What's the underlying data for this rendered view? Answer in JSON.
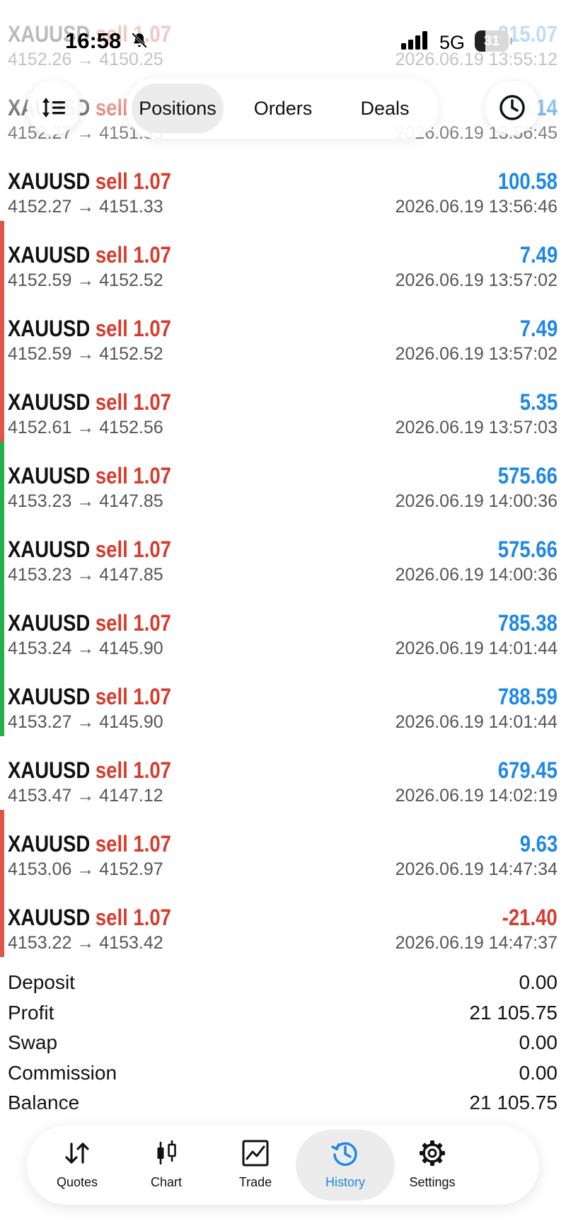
{
  "status_bar": {
    "time": "16:58",
    "network": "5G",
    "battery": "31",
    "battery_level": 0.31
  },
  "segments": {
    "positions": "Positions",
    "orders": "Orders",
    "deals": "Deals",
    "active": "positions"
  },
  "colors": {
    "sell": "#d43d2e",
    "profit_positive": "#1e88e5",
    "profit_negative": "#d43d2e",
    "group_red": "#e05546",
    "group_green": "#22b24c",
    "active_tab": "#1e88e5"
  },
  "deals": [
    {
      "symbol": "XAUUSD",
      "side": "sell",
      "volume": "1.07",
      "prices": "4152.26 → 4150.25",
      "profit": "215.07",
      "time": "2026.06.19 13:55:12",
      "negative": false,
      "group": "none"
    },
    {
      "symbol": "XAUUSD",
      "side": "sell",
      "volume": "1.07",
      "prices": "4152.27 → 4151.33",
      "profit": "100.14",
      "time": "2026.06.19 13:56:45",
      "negative": false,
      "group": "none"
    },
    {
      "symbol": "XAUUSD",
      "side": "sell",
      "volume": "1.07",
      "prices": "4152.27 → 4151.33",
      "profit": "100.58",
      "time": "2026.06.19 13:56:46",
      "negative": false,
      "group": "none"
    },
    {
      "symbol": "XAUUSD",
      "side": "sell",
      "volume": "1.07",
      "prices": "4152.59 → 4152.52",
      "profit": "7.49",
      "time": "2026.06.19 13:57:02",
      "negative": false,
      "group": "red"
    },
    {
      "symbol": "XAUUSD",
      "side": "sell",
      "volume": "1.07",
      "prices": "4152.59 → 4152.52",
      "profit": "7.49",
      "time": "2026.06.19 13:57:02",
      "negative": false,
      "group": "red"
    },
    {
      "symbol": "XAUUSD",
      "side": "sell",
      "volume": "1.07",
      "prices": "4152.61 → 4152.56",
      "profit": "5.35",
      "time": "2026.06.19 13:57:03",
      "negative": false,
      "group": "red"
    },
    {
      "symbol": "XAUUSD",
      "side": "sell",
      "volume": "1.07",
      "prices": "4153.23 → 4147.85",
      "profit": "575.66",
      "time": "2026.06.19 14:00:36",
      "negative": false,
      "group": "green"
    },
    {
      "symbol": "XAUUSD",
      "side": "sell",
      "volume": "1.07",
      "prices": "4153.23 → 4147.85",
      "profit": "575.66",
      "time": "2026.06.19 14:00:36",
      "negative": false,
      "group": "green"
    },
    {
      "symbol": "XAUUSD",
      "side": "sell",
      "volume": "1.07",
      "prices": "4153.24 → 4145.90",
      "profit": "785.38",
      "time": "2026.06.19 14:01:44",
      "negative": false,
      "group": "green"
    },
    {
      "symbol": "XAUUSD",
      "side": "sell",
      "volume": "1.07",
      "prices": "4153.27 → 4145.90",
      "profit": "788.59",
      "time": "2026.06.19 14:01:44",
      "negative": false,
      "group": "green"
    },
    {
      "symbol": "XAUUSD",
      "side": "sell",
      "volume": "1.07",
      "prices": "4153.47 → 4147.12",
      "profit": "679.45",
      "time": "2026.06.19 14:02:19",
      "negative": false,
      "group": "none"
    },
    {
      "symbol": "XAUUSD",
      "side": "sell",
      "volume": "1.07",
      "prices": "4153.06 → 4152.97",
      "profit": "9.63",
      "time": "2026.06.19 14:47:34",
      "negative": false,
      "group": "red"
    },
    {
      "symbol": "XAUUSD",
      "side": "sell",
      "volume": "1.07",
      "prices": "4153.22 → 4153.42",
      "profit": "-21.40",
      "time": "2026.06.19 14:47:37",
      "negative": true,
      "group": "red"
    }
  ],
  "summary": [
    {
      "label": "Deposit",
      "value": "0.00"
    },
    {
      "label": "Profit",
      "value": "21 105.75"
    },
    {
      "label": "Swap",
      "value": "0.00"
    },
    {
      "label": "Commission",
      "value": "0.00"
    },
    {
      "label": "Balance",
      "value": "21 105.75"
    }
  ],
  "nav": {
    "quotes": "Quotes",
    "chart": "Chart",
    "trade": "Trade",
    "history": "History",
    "settings": "Settings",
    "active": "history"
  },
  "icons": {
    "sort": "sort-list-icon",
    "clock": "clock-icon",
    "bell": "bell-muted-icon"
  }
}
